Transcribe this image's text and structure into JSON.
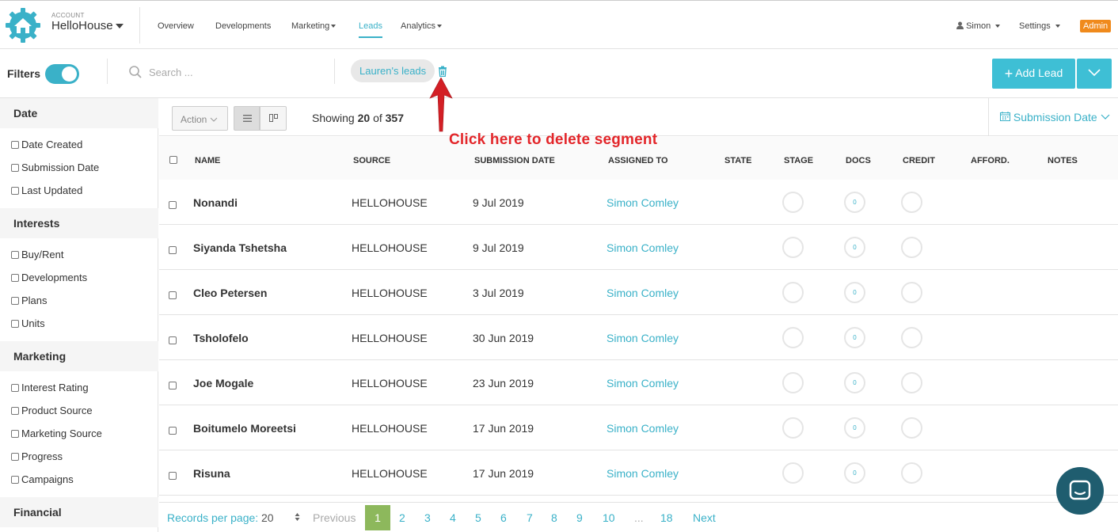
{
  "header": {
    "account_small": "ACCOUNT",
    "account_name": "HelloHouse",
    "nav": [
      {
        "label": "Overview"
      },
      {
        "label": "Developments"
      },
      {
        "label": "Marketing"
      },
      {
        "label": "Leads"
      },
      {
        "label": "Analytics"
      }
    ],
    "user": "Simon",
    "settings": "Settings",
    "admin_badge": "Admin"
  },
  "filterbar": {
    "filters_label": "Filters",
    "filters_on": true,
    "search_placeholder": "Search ...",
    "segment_label": "Lauren's leads",
    "add_lead": "Add Lead"
  },
  "annotation": {
    "text": "Click here to delete segment"
  },
  "sidebar": {
    "sections": [
      {
        "title": "Date",
        "items": [
          "Date Created",
          "Submission Date",
          "Last Updated"
        ]
      },
      {
        "title": "Interests",
        "items": [
          "Buy/Rent",
          "Developments",
          "Plans",
          "Units"
        ]
      },
      {
        "title": "Marketing",
        "items": [
          "Interest Rating",
          "Product Source",
          "Marketing Source",
          "Progress",
          "Campaigns"
        ]
      },
      {
        "title": "Financial",
        "items": []
      }
    ]
  },
  "toolbar": {
    "action_label": "Action",
    "showing_prefix": "Showing",
    "showing_count": "20",
    "showing_of": "of",
    "showing_total": "357",
    "sort_label": "Submission Date"
  },
  "table": {
    "columns": [
      "NAME",
      "SOURCE",
      "SUBMISSION DATE",
      "ASSIGNED TO",
      "STATE",
      "STAGE",
      "DOCS",
      "CREDIT",
      "AFFORD.",
      "NOTES"
    ],
    "rows": [
      {
        "name": "Nonandi",
        "source": "HELLOHOUSE",
        "date": "9 Jul 2019",
        "assigned": "Simon Comley",
        "docs": "0"
      },
      {
        "name": "Siyanda Tshetsha",
        "source": "HELLOHOUSE",
        "date": "9 Jul 2019",
        "assigned": "Simon Comley",
        "docs": "0"
      },
      {
        "name": "Cleo Petersen",
        "source": "HELLOHOUSE",
        "date": "3 Jul 2019",
        "assigned": "Simon Comley",
        "docs": "0"
      },
      {
        "name": "Tsholofelo",
        "source": "HELLOHOUSE",
        "date": "30 Jun 2019",
        "assigned": "Simon Comley",
        "docs": "0"
      },
      {
        "name": "Joe Mogale",
        "source": "HELLOHOUSE",
        "date": "23 Jun 2019",
        "assigned": "Simon Comley",
        "docs": "0"
      },
      {
        "name": "Boitumelo Moreetsi",
        "source": "HELLOHOUSE",
        "date": "17 Jun 2019",
        "assigned": "Simon Comley",
        "docs": "0"
      },
      {
        "name": "Risuna",
        "source": "HELLOHOUSE",
        "date": "17 Jun 2019",
        "assigned": "Simon Comley",
        "docs": "0"
      }
    ]
  },
  "pager": {
    "records_label": "Records per page:",
    "per_page": "20",
    "previous": "Previous",
    "pages": [
      "1",
      "2",
      "3",
      "4",
      "5",
      "6",
      "7",
      "8",
      "9",
      "10",
      "...",
      "18"
    ],
    "current_page": "1",
    "next": "Next"
  },
  "colors": {
    "accent": "#3ab1c8",
    "button": "#3ebfd5",
    "admin": "#f08a1c",
    "active_page": "#8db85c",
    "annotation": "#e3262a",
    "chat": "#1f5d6f"
  }
}
